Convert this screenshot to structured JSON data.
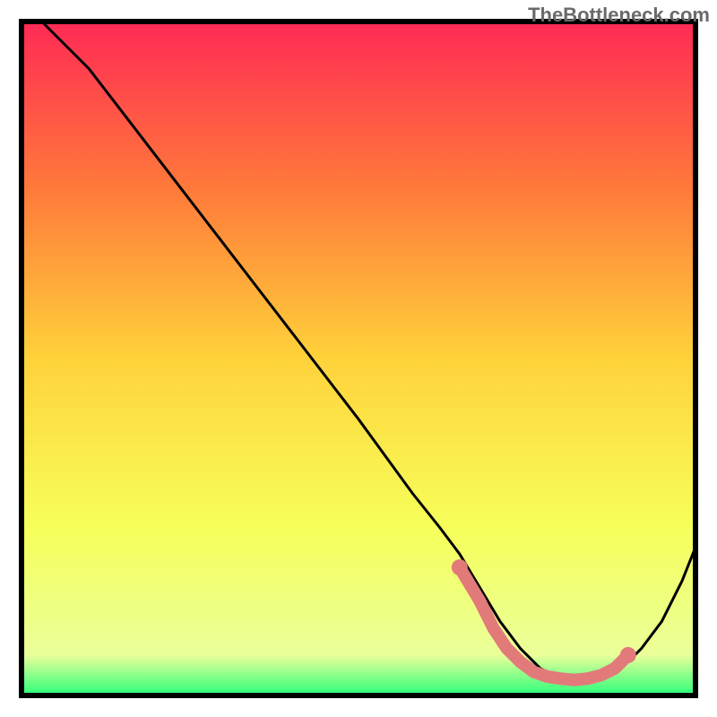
{
  "watermark": "TheBottleneck.com",
  "chart_data": {
    "type": "line",
    "title": "",
    "xlabel": "",
    "ylabel": "",
    "xlim": [
      0,
      100
    ],
    "ylim": [
      0,
      100
    ],
    "series": [
      {
        "name": "bottleneck-curve",
        "color": "#000000",
        "x": [
          3,
          10,
          20,
          30,
          40,
          50,
          58,
          62,
          65,
          68,
          71,
          74,
          77,
          80,
          83,
          86,
          89,
          92,
          95,
          98,
          100
        ],
        "y": [
          100,
          93,
          80,
          67,
          54,
          41,
          30,
          25,
          21,
          16,
          11,
          7,
          4,
          2.5,
          2,
          2.5,
          4,
          7,
          11,
          17,
          22
        ]
      }
    ],
    "highlight_points": {
      "name": "bottleneck-optimal-zone",
      "color": "#e27a7a",
      "x": [
        65,
        68,
        70,
        72,
        74,
        76,
        78,
        80,
        82,
        84,
        86,
        88,
        90
      ],
      "y": [
        19,
        14,
        10,
        7,
        5,
        3.5,
        2.8,
        2.5,
        2.3,
        2.5,
        3,
        4,
        6
      ]
    },
    "gradient_stops": [
      {
        "offset": 0,
        "color": "#ff2a55"
      },
      {
        "offset": 25,
        "color": "#ff7a3a"
      },
      {
        "offset": 50,
        "color": "#ffd23a"
      },
      {
        "offset": 75,
        "color": "#f6ff5a"
      },
      {
        "offset": 94,
        "color": "#eaff9a"
      },
      {
        "offset": 100,
        "color": "#2aff7a"
      }
    ]
  }
}
